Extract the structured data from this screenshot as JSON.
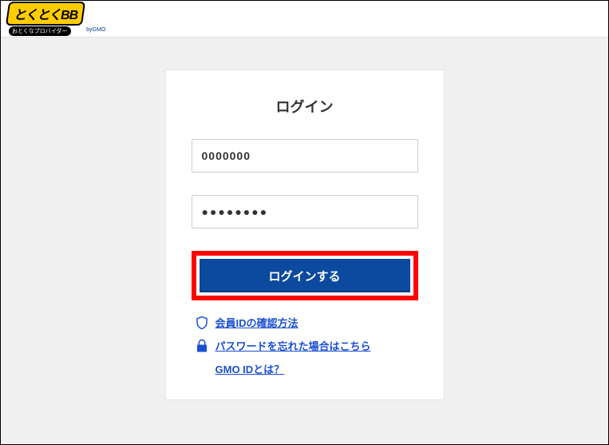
{
  "header": {
    "logo_text": "とくとくBB",
    "logo_sub": "おとくなプロバイダー",
    "logo_gmo": "byGMO"
  },
  "login": {
    "title": "ログイン",
    "id_value": "0000000",
    "pw_value": "●●●●●●●●",
    "button_label": "ログインする"
  },
  "links": {
    "confirm_id": "会員IDの確認方法",
    "forgot_pw": "パスワードを忘れた場合はこちら",
    "gmo_id": "GMO IDとは？"
  }
}
